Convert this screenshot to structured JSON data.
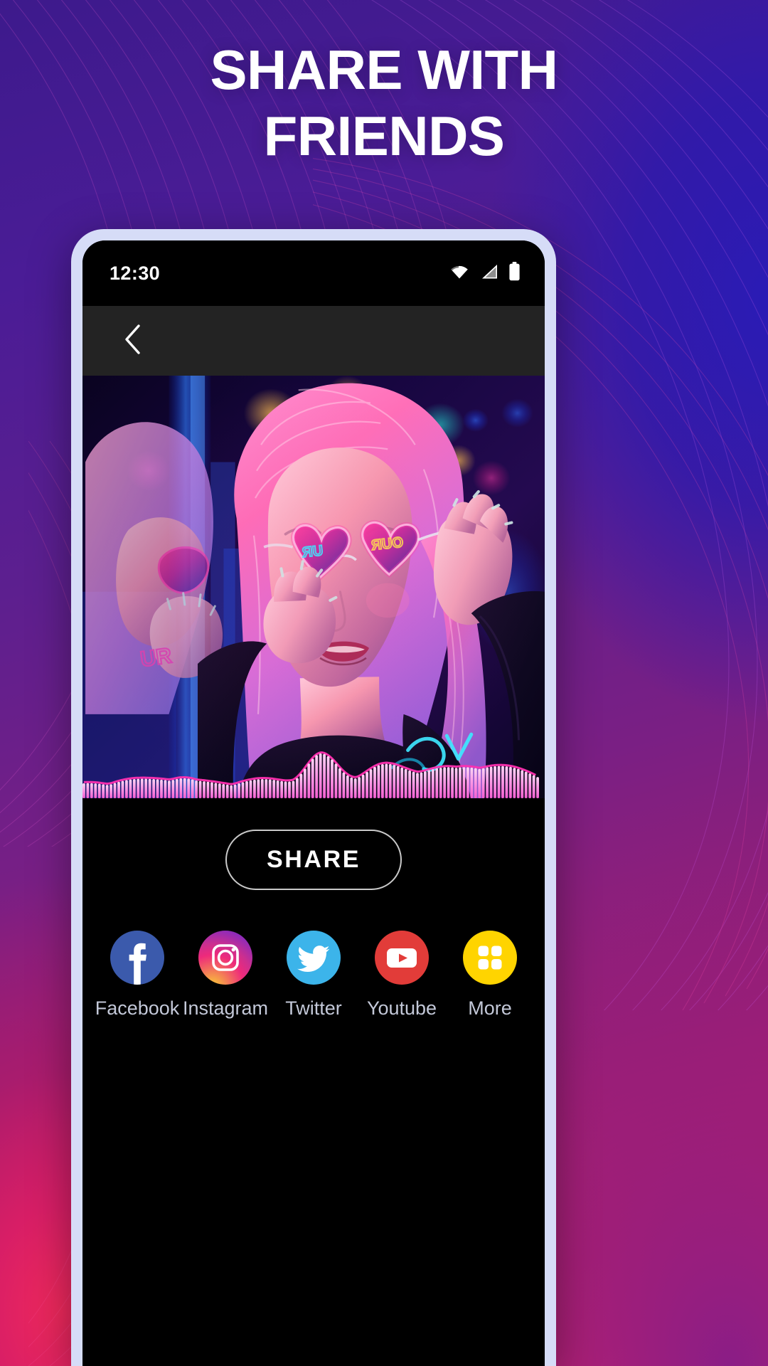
{
  "headline": {
    "line1": "SHARE WITH",
    "line2": "FRIENDS"
  },
  "colors": {
    "bg_start": "#3d1a8c",
    "bg_end": "#e8245a",
    "phone_bezel": "#d6dcf7",
    "screen_bg": "#000000",
    "navbar_bg": "#232323",
    "waveform_pink": "#ff2fb0",
    "waveform_fill": "#f7a8e6",
    "share_border": "#c9c9c9",
    "label_text": "#c3c8d8",
    "facebook": "#3b5aac",
    "instagram": "#ee2a7b",
    "twitter": "#3cb4ea",
    "youtube": "#e23c39",
    "more": "#ffd400"
  },
  "phone": {
    "statusbar": {
      "time": "12:30",
      "icons": [
        "wifi-icon",
        "cellular-signal-icon",
        "battery-icon"
      ]
    },
    "navbar": {
      "back_icon": "back-chevron-icon"
    },
    "media": {
      "description": "neon portrait of woman wearing heart-shaped sunglasses",
      "waveform_label": "audio-waveform-visualizer"
    },
    "share_button": {
      "label": "SHARE"
    },
    "social": [
      {
        "id": "facebook",
        "label": "Facebook",
        "icon": "facebook-icon"
      },
      {
        "id": "instagram",
        "label": "Instagram",
        "icon": "instagram-icon"
      },
      {
        "id": "twitter",
        "label": "Twitter",
        "icon": "twitter-icon"
      },
      {
        "id": "youtube",
        "label": "Youtube",
        "icon": "youtube-icon"
      },
      {
        "id": "more",
        "label": "More",
        "icon": "more-apps-grid-icon"
      }
    ]
  }
}
